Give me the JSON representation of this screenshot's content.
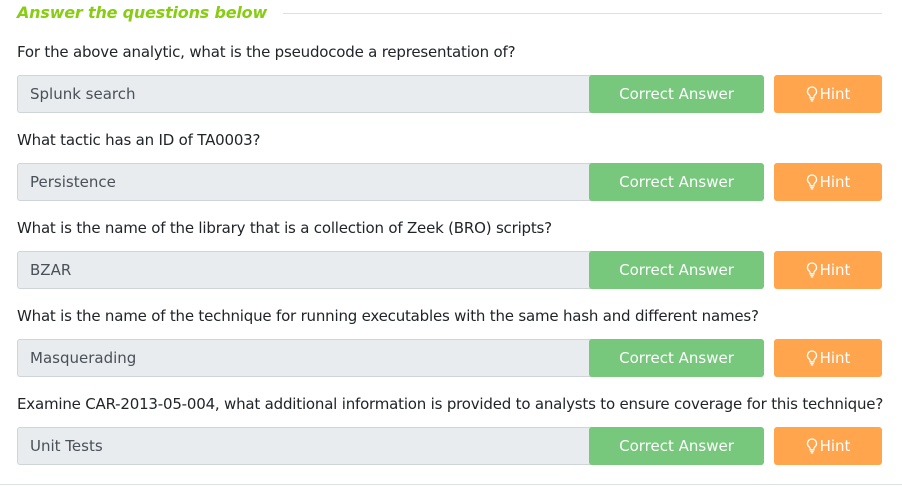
{
  "header": {
    "title": "Answer the questions below"
  },
  "colors": {
    "accent": "#88cc14",
    "correct": "#77c77c",
    "hint": "#ffa54d",
    "answer_bg": "#e9ecef"
  },
  "questions": [
    {
      "text": "For the above analytic, what is the pseudocode a representation of?",
      "answer": "Splunk search",
      "correct_label": "Correct Answer",
      "hint_label": "Hint",
      "hint_icon": "lightbulb-icon"
    },
    {
      "text": "What tactic has an ID of TA0003?",
      "answer": "Persistence",
      "correct_label": "Correct Answer",
      "hint_label": "Hint",
      "hint_icon": "lightbulb-icon"
    },
    {
      "text": "What is the name of the library that is a collection of Zeek (BRO) scripts?",
      "answer": "BZAR",
      "correct_label": "Correct Answer",
      "hint_label": "Hint",
      "hint_icon": "lightbulb-icon"
    },
    {
      "text": "What is the name of the technique for running executables with the same hash and different names?",
      "answer": "Masquerading",
      "correct_label": "Correct Answer",
      "hint_label": "Hint",
      "hint_icon": "lightbulb-icon"
    },
    {
      "text": "Examine CAR-2013-05-004, what additional information is provided to analysts to ensure coverage for this technique?",
      "answer": "Unit Tests",
      "correct_label": "Correct Answer",
      "hint_label": "Hint",
      "hint_icon": "lightbulb-icon"
    }
  ]
}
